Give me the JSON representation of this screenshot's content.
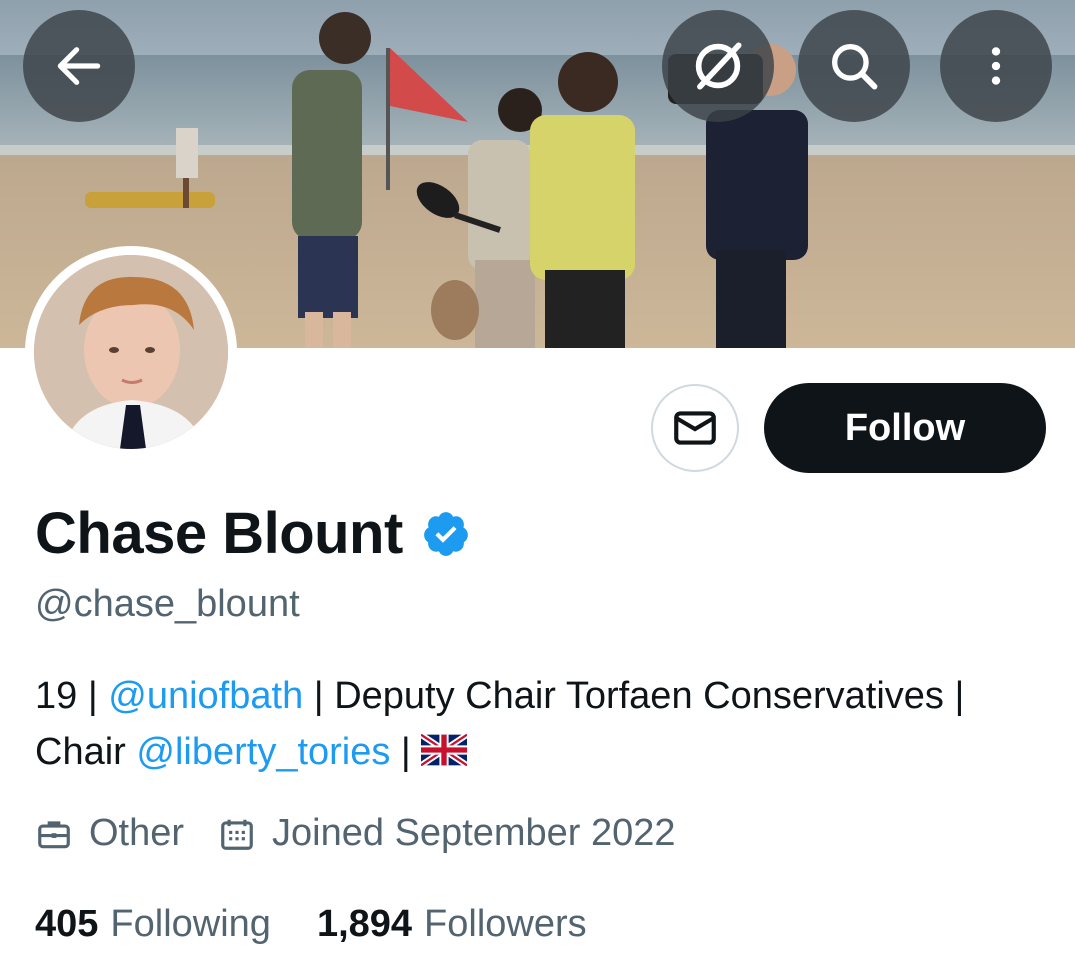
{
  "header": {
    "back_icon": "arrow-left-icon",
    "follow_topic_icon": "slashed-circle-icon",
    "search_icon": "search-icon",
    "more_icon": "more-vertical-icon"
  },
  "profile": {
    "name": "Chase Blount",
    "verified": true,
    "handle": "@chase_blount",
    "bio": {
      "prefix": "19 | ",
      "mention1": "@uniofbath",
      "middle": " | Deputy Chair Torfaen Conservatives | Chair ",
      "mention2": "@liberty_tories",
      "suffix": " | "
    },
    "category": "Other",
    "joined": "Joined September 2022",
    "following_count": "405",
    "following_label": "Following",
    "followers_count": "1,894",
    "followers_label": "Followers"
  },
  "actions": {
    "follow_label": "Follow",
    "message_icon": "envelope-icon"
  },
  "colors": {
    "accent": "#1d9bf0",
    "text": "#0f1419",
    "secondary": "#536471",
    "button": "#0f1419"
  }
}
